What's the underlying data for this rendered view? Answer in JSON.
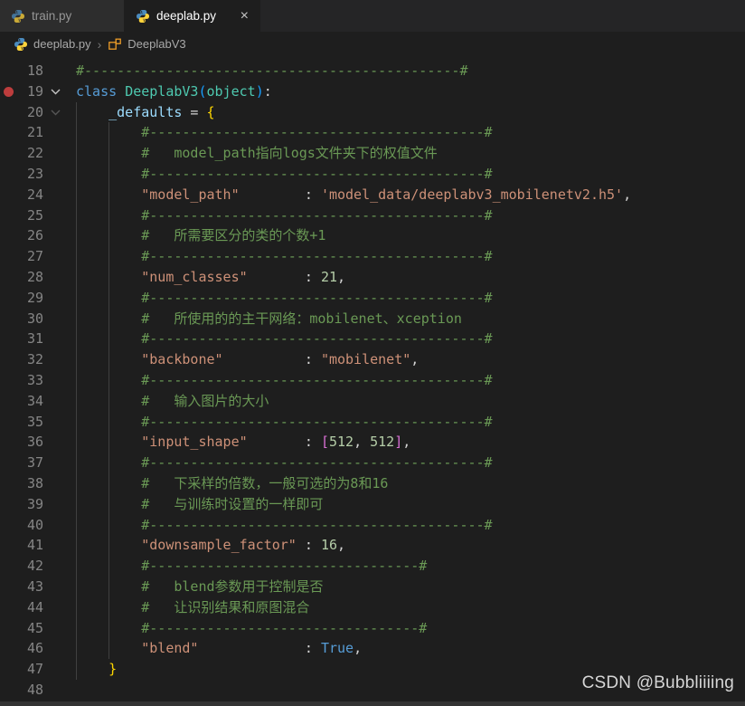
{
  "tab_bar": {
    "tabs": [
      {
        "label": "train.py",
        "active": false,
        "icon": "python-icon"
      },
      {
        "label": "deeplab.py",
        "active": true,
        "icon": "python-icon",
        "close_icon": "×"
      }
    ]
  },
  "breadcrumb": {
    "file": "deeplab.py",
    "separator": "›",
    "symbol": "DeeplabV3",
    "file_icon": "python-icon",
    "symbol_icon": "symbol-class-icon"
  },
  "colors": {
    "comment": "#6A9955",
    "string": "#CE9178",
    "keyword": "#569CD6",
    "class_name": "#4EC9B0",
    "variable": "#9CDCFE",
    "number": "#B5CEA8",
    "operator": "#D4D4D4",
    "brace": "#FFD700",
    "bracket": "#DA70D6",
    "paren": "#179FFF",
    "breakpoint": "#BD3D3D"
  },
  "editor": {
    "guides": [
      {
        "indent_ch": 0,
        "from_line": 20,
        "to_line": 47
      },
      {
        "indent_ch": 4,
        "from_line": 21,
        "to_line": 46
      }
    ],
    "lines": [
      {
        "n": 18,
        "tokens": [
          {
            "c": "comment",
            "t": "#----------------------------------------------#"
          }
        ]
      },
      {
        "n": 19,
        "breakpoint": true,
        "fold": "bright",
        "tokens": [
          {
            "c": "kw",
            "t": "class "
          },
          {
            "c": "cls",
            "t": "DeeplabV3"
          },
          {
            "c": "paren",
            "t": "("
          },
          {
            "c": "cls",
            "t": "object"
          },
          {
            "c": "paren",
            "t": ")"
          },
          {
            "c": "op",
            "t": ":"
          }
        ]
      },
      {
        "n": 20,
        "fold": "dim",
        "tokens": [
          {
            "c": "plain",
            "t": "    "
          },
          {
            "c": "var",
            "t": "_defaults"
          },
          {
            "c": "op",
            "t": " = "
          },
          {
            "c": "brace",
            "t": "{"
          }
        ]
      },
      {
        "n": 21,
        "tokens": [
          {
            "c": "comment",
            "t": "        #-----------------------------------------#"
          }
        ]
      },
      {
        "n": 22,
        "tokens": [
          {
            "c": "comment",
            "t": "        #   model_path指向logs文件夹下的权值文件"
          }
        ]
      },
      {
        "n": 23,
        "tokens": [
          {
            "c": "comment",
            "t": "        #-----------------------------------------#"
          }
        ]
      },
      {
        "n": 24,
        "tokens": [
          {
            "c": "plain",
            "t": "        "
          },
          {
            "c": "str",
            "t": "\"model_path\""
          },
          {
            "c": "plain",
            "t": "        "
          },
          {
            "c": "op",
            "t": ": "
          },
          {
            "c": "str",
            "t": "'model_data/deeplabv3_mobilenetv2.h5'"
          },
          {
            "c": "op",
            "t": ","
          }
        ]
      },
      {
        "n": 25,
        "tokens": [
          {
            "c": "comment",
            "t": "        #-----------------------------------------#"
          }
        ]
      },
      {
        "n": 26,
        "tokens": [
          {
            "c": "comment",
            "t": "        #   所需要区分的类的个数+1"
          }
        ]
      },
      {
        "n": 27,
        "tokens": [
          {
            "c": "comment",
            "t": "        #-----------------------------------------#"
          }
        ]
      },
      {
        "n": 28,
        "tokens": [
          {
            "c": "plain",
            "t": "        "
          },
          {
            "c": "str",
            "t": "\"num_classes\""
          },
          {
            "c": "plain",
            "t": "       "
          },
          {
            "c": "op",
            "t": ": "
          },
          {
            "c": "num",
            "t": "21"
          },
          {
            "c": "op",
            "t": ","
          }
        ]
      },
      {
        "n": 29,
        "tokens": [
          {
            "c": "comment",
            "t": "        #-----------------------------------------#"
          }
        ]
      },
      {
        "n": 30,
        "tokens": [
          {
            "c": "comment",
            "t": "        #   所使用的的主干网络：mobilenet、xception"
          }
        ]
      },
      {
        "n": 31,
        "tokens": [
          {
            "c": "comment",
            "t": "        #-----------------------------------------#"
          }
        ]
      },
      {
        "n": 32,
        "tokens": [
          {
            "c": "plain",
            "t": "        "
          },
          {
            "c": "str",
            "t": "\"backbone\""
          },
          {
            "c": "plain",
            "t": "          "
          },
          {
            "c": "op",
            "t": ": "
          },
          {
            "c": "str",
            "t": "\"mobilenet\""
          },
          {
            "c": "op",
            "t": ","
          }
        ]
      },
      {
        "n": 33,
        "tokens": [
          {
            "c": "comment",
            "t": "        #-----------------------------------------#"
          }
        ]
      },
      {
        "n": 34,
        "tokens": [
          {
            "c": "comment",
            "t": "        #   输入图片的大小"
          }
        ]
      },
      {
        "n": 35,
        "tokens": [
          {
            "c": "comment",
            "t": "        #-----------------------------------------#"
          }
        ]
      },
      {
        "n": 36,
        "tokens": [
          {
            "c": "plain",
            "t": "        "
          },
          {
            "c": "str",
            "t": "\"input_shape\""
          },
          {
            "c": "plain",
            "t": "       "
          },
          {
            "c": "op",
            "t": ": "
          },
          {
            "c": "bracket",
            "t": "["
          },
          {
            "c": "num",
            "t": "512"
          },
          {
            "c": "op",
            "t": ", "
          },
          {
            "c": "num",
            "t": "512"
          },
          {
            "c": "bracket",
            "t": "]"
          },
          {
            "c": "op",
            "t": ","
          }
        ]
      },
      {
        "n": 37,
        "tokens": [
          {
            "c": "comment",
            "t": "        #-----------------------------------------#"
          }
        ]
      },
      {
        "n": 38,
        "tokens": [
          {
            "c": "comment",
            "t": "        #   下采样的倍数，一般可选的为8和16"
          }
        ]
      },
      {
        "n": 39,
        "tokens": [
          {
            "c": "comment",
            "t": "        #   与训练时设置的一样即可"
          }
        ]
      },
      {
        "n": 40,
        "tokens": [
          {
            "c": "comment",
            "t": "        #-----------------------------------------#"
          }
        ]
      },
      {
        "n": 41,
        "tokens": [
          {
            "c": "plain",
            "t": "        "
          },
          {
            "c": "str",
            "t": "\"downsample_factor\""
          },
          {
            "c": "plain",
            "t": " "
          },
          {
            "c": "op",
            "t": ": "
          },
          {
            "c": "num",
            "t": "16"
          },
          {
            "c": "op",
            "t": ","
          }
        ]
      },
      {
        "n": 42,
        "tokens": [
          {
            "c": "comment",
            "t": "        #---------------------------------#"
          }
        ]
      },
      {
        "n": 43,
        "tokens": [
          {
            "c": "comment",
            "t": "        #   blend参数用于控制是否"
          }
        ]
      },
      {
        "n": 44,
        "tokens": [
          {
            "c": "comment",
            "t": "        #   让识别结果和原图混合"
          }
        ]
      },
      {
        "n": 45,
        "tokens": [
          {
            "c": "comment",
            "t": "        #---------------------------------#"
          }
        ]
      },
      {
        "n": 46,
        "tokens": [
          {
            "c": "plain",
            "t": "        "
          },
          {
            "c": "str",
            "t": "\"blend\""
          },
          {
            "c": "plain",
            "t": "             "
          },
          {
            "c": "op",
            "t": ": "
          },
          {
            "c": "kw",
            "t": "True"
          },
          {
            "c": "op",
            "t": ","
          }
        ]
      },
      {
        "n": 47,
        "tokens": [
          {
            "c": "plain",
            "t": "    "
          },
          {
            "c": "brace",
            "t": "}"
          }
        ]
      },
      {
        "n": 48,
        "tokens": []
      }
    ]
  },
  "watermark": "CSDN @Bubbliiiing"
}
